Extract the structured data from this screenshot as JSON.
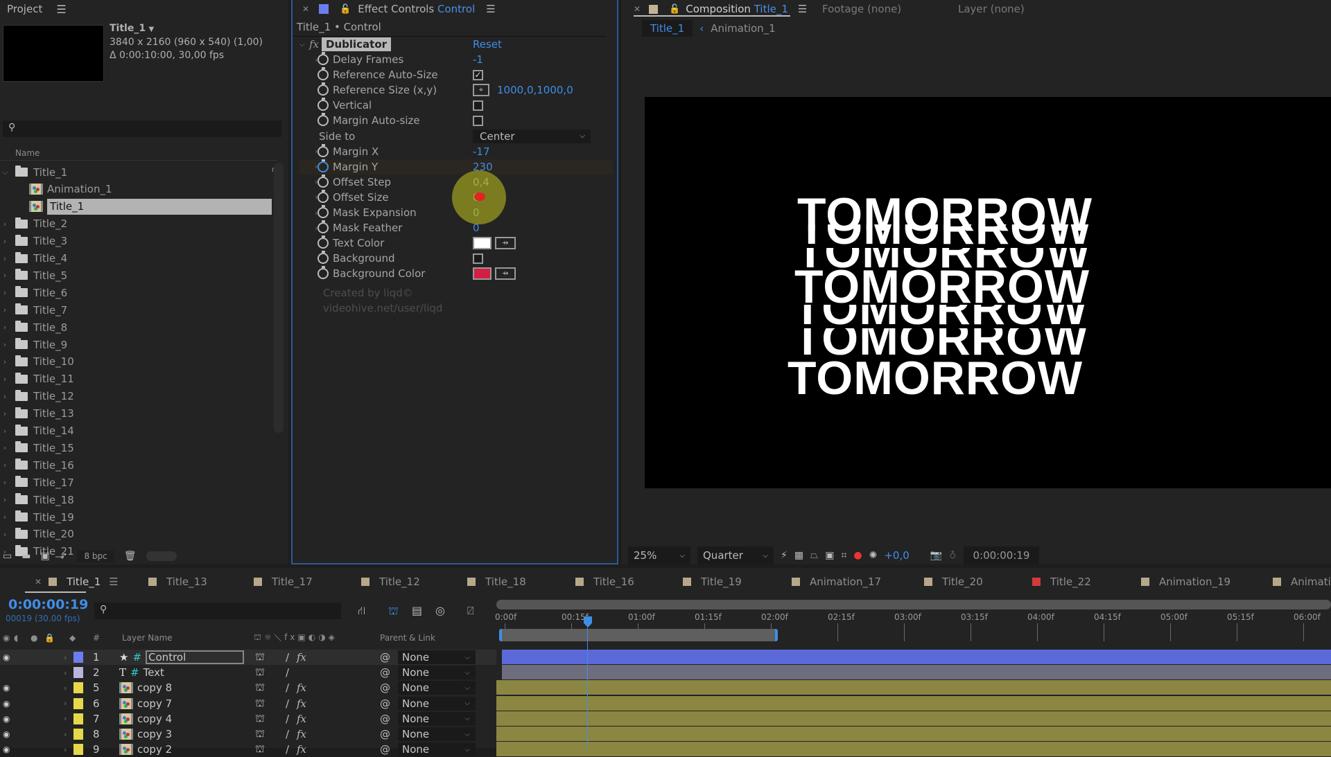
{
  "project": {
    "title": "Project",
    "selected_item": {
      "name": "Title_1",
      "resolution": "3840 x 2160  (960 x 540) (1,00)",
      "duration": "Δ 0:00:10:00, 30,00 fps"
    },
    "column_name": "Name",
    "items": [
      {
        "name": "Title_1",
        "type": "folder",
        "expanded": true
      },
      {
        "name": "Animation_1",
        "type": "comp",
        "indent": true
      },
      {
        "name": "Title_1",
        "type": "comp",
        "indent": true,
        "selected": true
      },
      {
        "name": "Title_2",
        "type": "folder"
      },
      {
        "name": "Title_3",
        "type": "folder"
      },
      {
        "name": "Title_4",
        "type": "folder"
      },
      {
        "name": "Title_5",
        "type": "folder"
      },
      {
        "name": "Title_6",
        "type": "folder"
      },
      {
        "name": "Title_7",
        "type": "folder"
      },
      {
        "name": "Title_8",
        "type": "folder"
      },
      {
        "name": "Title_9",
        "type": "folder"
      },
      {
        "name": "Title_10",
        "type": "folder"
      },
      {
        "name": "Title_11",
        "type": "folder"
      },
      {
        "name": "Title_12",
        "type": "folder"
      },
      {
        "name": "Title_13",
        "type": "folder"
      },
      {
        "name": "Title_14",
        "type": "folder"
      },
      {
        "name": "Title_15",
        "type": "folder"
      },
      {
        "name": "Title_16",
        "type": "folder"
      },
      {
        "name": "Title_17",
        "type": "folder"
      },
      {
        "name": "Title_18",
        "type": "folder"
      },
      {
        "name": "Title_19",
        "type": "folder"
      },
      {
        "name": "Title_20",
        "type": "folder"
      },
      {
        "name": "Title_21",
        "type": "folder"
      }
    ],
    "bpc": "8 bpc"
  },
  "effect_controls": {
    "title": "Effect Controls",
    "layer": "Control",
    "breadcrumb": "Title_1 • Control",
    "effect_name": "Dublicator",
    "reset_label": "Reset",
    "properties": [
      {
        "label": "Delay Frames",
        "value": "-1",
        "kind": "number",
        "expandable": true
      },
      {
        "label": "Reference Auto-Size",
        "kind": "checkbox",
        "checked": true
      },
      {
        "label": "Reference Size (x,y)",
        "value": "1000,0,1000,0",
        "kind": "point"
      },
      {
        "label": "Vertical",
        "kind": "checkbox",
        "checked": false
      },
      {
        "label": "Margin Auto-size",
        "kind": "checkbox",
        "checked": false
      },
      {
        "label": "Side to",
        "value": "Center",
        "kind": "dropdown"
      },
      {
        "label": "Margin X",
        "value": "-17",
        "kind": "number",
        "expandable": true
      },
      {
        "label": "Margin Y",
        "value": "230",
        "kind": "number",
        "expandable": true,
        "keyframed": true
      },
      {
        "label": "Offset Step",
        "value": "0,4",
        "kind": "number",
        "expandable": true
      },
      {
        "label": "Offset Size",
        "value": "0",
        "kind": "number",
        "expandable": true
      },
      {
        "label": "Mask Expansion",
        "value": "0",
        "kind": "number",
        "expandable": true
      },
      {
        "label": "Mask Feather",
        "value": "0",
        "kind": "number",
        "expandable": true
      },
      {
        "label": "Text Color",
        "kind": "color",
        "color": "#ffffff"
      },
      {
        "label": "Background",
        "kind": "checkbox",
        "checked": false
      },
      {
        "label": "Background Color",
        "kind": "color",
        "color": "#d21f45"
      }
    ],
    "credit_line1": "Created by liqd©",
    "credit_line2": "videohive.net/user/liqd"
  },
  "composition": {
    "tab_label": "Composition",
    "comp_name": "Title_1",
    "footage_tab": "Footage  (none)",
    "layer_tab": "Layer  (none)",
    "breadcrumbs": [
      "Title_1",
      "Animation_1"
    ],
    "preview_text": "TOMORROW",
    "preview_lines": 7,
    "zoom": "25%",
    "resolution": "Quarter",
    "exposure": "+0,0",
    "timecode": "0:00:00:19"
  },
  "timeline": {
    "tabs": [
      {
        "label": "Title_1",
        "color": "#b8a88a",
        "active": true
      },
      {
        "label": "Title_13",
        "color": "#b8a88a"
      },
      {
        "label": "Title_17",
        "color": "#b8a88a"
      },
      {
        "label": "Title_12",
        "color": "#b8a88a"
      },
      {
        "label": "Title_18",
        "color": "#b8a88a"
      },
      {
        "label": "Title_16",
        "color": "#b8a88a"
      },
      {
        "label": "Title_19",
        "color": "#b8a88a"
      },
      {
        "label": "Animation_17",
        "color": "#b8a88a"
      },
      {
        "label": "Title_20",
        "color": "#b8a88a"
      },
      {
        "label": "Title_22",
        "color": "#d43a3a"
      },
      {
        "label": "Animation_19",
        "color": "#b8a88a"
      },
      {
        "label": "Animatic",
        "color": "#b8a88a"
      }
    ],
    "current_time": "0:00:00:19",
    "frame_info": "00019 (30.00 fps)",
    "columns": {
      "layer_name": "Layer Name",
      "number": "#",
      "parent": "Parent & Link"
    },
    "ruler": [
      "0:00f",
      "00:15f",
      "01:00f",
      "01:15f",
      "02:00f",
      "02:15f",
      "03:00f",
      "03:15f",
      "04:00f",
      "04:15f",
      "05:00f",
      "05:15f",
      "06:00f"
    ],
    "layers": [
      {
        "num": "1",
        "name": "Control",
        "type": "null",
        "label_color": "#6b7ef0",
        "parent": "None",
        "fx": true,
        "bar_color": "#5b6ad8"
      },
      {
        "num": "2",
        "name": "Text",
        "type": "text",
        "label_color": "#b9b4dc",
        "parent": "None",
        "fx": false,
        "bar_color": "#6e6d7d"
      },
      {
        "num": "5",
        "name": "copy 8",
        "type": "comp",
        "label_color": "#e6d84a",
        "parent": "None",
        "fx": true,
        "bar_color": "#8b8642"
      },
      {
        "num": "6",
        "name": "copy 7",
        "type": "comp",
        "label_color": "#e6d84a",
        "parent": "None",
        "fx": true,
        "bar_color": "#8b8642"
      },
      {
        "num": "7",
        "name": "copy 4",
        "type": "comp",
        "label_color": "#e6d84a",
        "parent": "None",
        "fx": true,
        "bar_color": "#8b8642"
      },
      {
        "num": "8",
        "name": "copy 3",
        "type": "comp",
        "label_color": "#e6d84a",
        "parent": "None",
        "fx": true,
        "bar_color": "#8b8642"
      },
      {
        "num": "9",
        "name": "copy 2",
        "type": "comp",
        "label_color": "#e6d84a",
        "parent": "None",
        "fx": true,
        "bar_color": "#8b8642"
      }
    ]
  }
}
